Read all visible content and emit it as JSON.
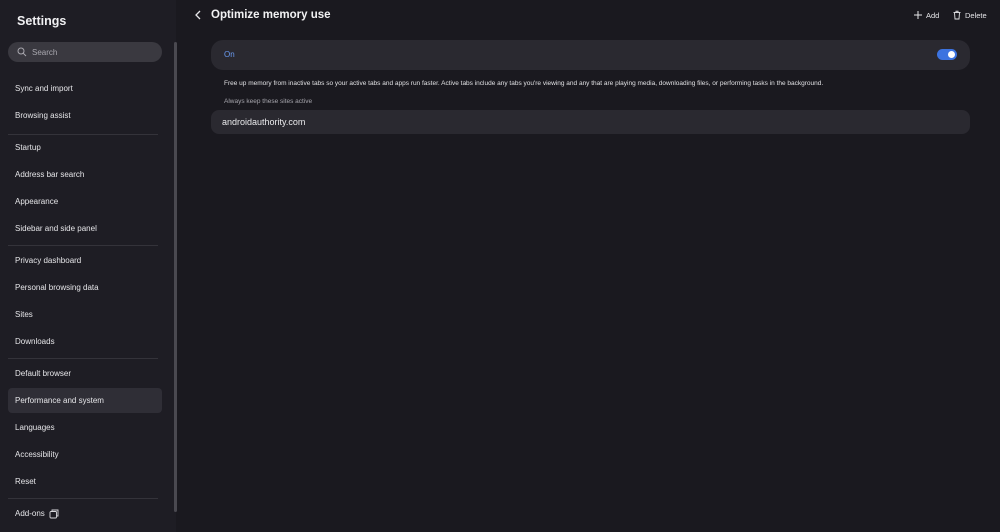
{
  "sidebar": {
    "title": "Settings",
    "search_placeholder": "Search",
    "items": [
      {
        "label": "Sync and import"
      },
      {
        "label": "Browsing assist"
      },
      {
        "label": "Startup"
      },
      {
        "label": "Address bar search"
      },
      {
        "label": "Appearance"
      },
      {
        "label": "Sidebar and side panel"
      },
      {
        "label": "Privacy dashboard"
      },
      {
        "label": "Personal browsing data"
      },
      {
        "label": "Sites"
      },
      {
        "label": "Downloads"
      },
      {
        "label": "Default browser"
      },
      {
        "label": "Performance and system",
        "active": true
      },
      {
        "label": "Languages"
      },
      {
        "label": "Accessibility"
      },
      {
        "label": "Reset"
      },
      {
        "label": "Add-ons"
      }
    ]
  },
  "header": {
    "title": "Optimize memory use",
    "add_label": "Add",
    "delete_label": "Delete"
  },
  "toggle": {
    "label": "On",
    "enabled": true
  },
  "description": "Free up memory from inactive tabs so your active tabs and apps run faster. Active tabs include any tabs you're viewing and any that are playing media, downloading files, or performing tasks in the background.",
  "sites_section_label": "Always keep these sites active",
  "sites": [
    "androidauthority.com"
  ],
  "colors": {
    "background": "#1a191f",
    "sidebar": "#1e1d24",
    "card": "#2a2930",
    "accent": "#3c73e0",
    "accent_text": "#6a9af0"
  },
  "icons": [
    "search-icon",
    "chevron-left-icon",
    "plus-icon",
    "trash-icon",
    "open-external-icon"
  ]
}
